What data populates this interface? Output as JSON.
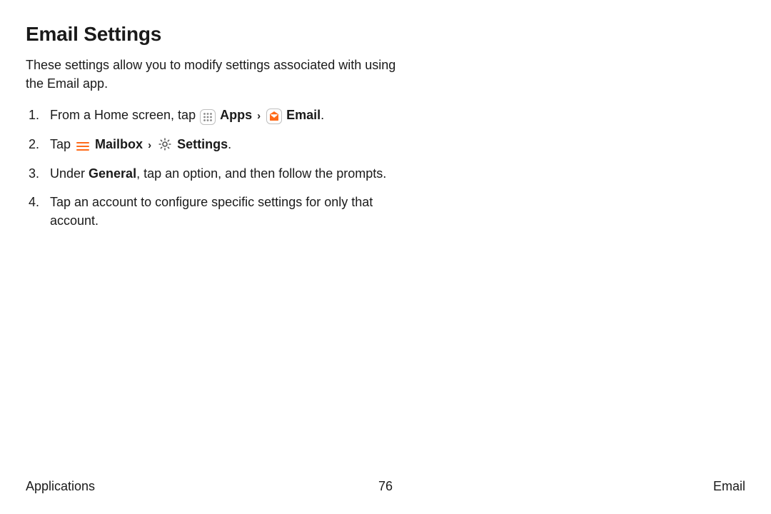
{
  "title": "Email Settings",
  "intro": "These settings allow you to modify settings associated with using the Email app.",
  "steps": {
    "s1_a": "From a Home screen, tap ",
    "s1_apps": "Apps",
    "s1_email": "Email",
    "s1_period": ".",
    "s2_a": "Tap ",
    "s2_mailbox": "Mailbox",
    "s2_settings": "Settings",
    "s2_period": ".",
    "s3_a": "Under ",
    "s3_general": "General",
    "s3_b": ", tap an option, and then follow the prompts.",
    "s4": "Tap an account to configure specific settings for only that account."
  },
  "chev": "›",
  "footer": {
    "left": "Applications",
    "center": "76",
    "right": "Email"
  }
}
